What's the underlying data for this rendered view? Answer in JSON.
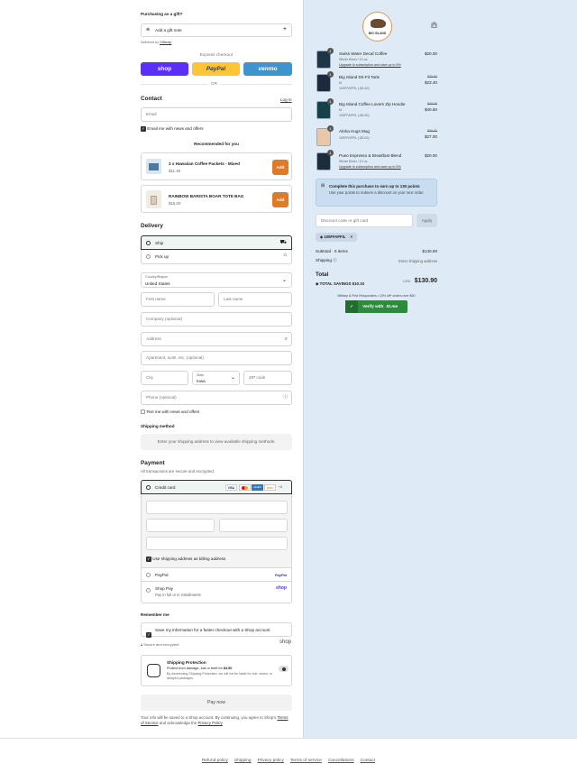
{
  "gift": {
    "title": "Purchasing as a gift?",
    "add_note": "Add a gift note",
    "delivered_by": "Delivered by",
    "delivered_by_brand": "Giftsnap"
  },
  "express": {
    "title": "Express checkout",
    "shop": "shop",
    "paypal": "PayPal",
    "venmo": "venmo",
    "or": "OR"
  },
  "contact": {
    "title": "Contact",
    "login": "Log in",
    "email_placeholder": "Email",
    "news": "Email me with news and offers"
  },
  "recommended": {
    "title": "Recommended for you",
    "items": [
      {
        "name": "3 x Hawaiian Coffee Packets - Mixed",
        "price": "$11.40",
        "add": "Add"
      },
      {
        "name": "RAINBOW BARISTA BOAR TOTE BAG",
        "price": "$15.00",
        "add": "Add"
      }
    ]
  },
  "delivery": {
    "title": "Delivery",
    "ship": "Ship",
    "pickup": "Pick up",
    "country_label": "Country/Region",
    "country": "United States",
    "first": "First name",
    "last": "Last name",
    "company": "Company (optional)",
    "address": "Address",
    "apt": "Apartment, suite, etc. (optional)",
    "city": "City",
    "state_label": "State",
    "state": "Iowa",
    "zip": "ZIP code",
    "phone": "Phone (optional)",
    "text_me": "Text me with news and offers"
  },
  "shipping_method": {
    "title": "Shipping method",
    "msg": "Enter your shipping address to view available shipping methods."
  },
  "payment": {
    "title": "Payment",
    "subtitle": "All transactions are secure and encrypted.",
    "credit": "Credit card",
    "cards": [
      "VISA",
      "MC",
      "AMEX",
      "DISC"
    ],
    "more": "+2",
    "billing": "Use shipping address as billing address",
    "paypal": "PayPal",
    "paypal_logo": "PayPal",
    "shoppay": "Shop Pay",
    "shoppay_sub": "Pay in full or in installments",
    "shoppay_logo": "shop"
  },
  "remember": {
    "title": "Remember me",
    "save": "Save my information for a faster checkout with a Shop account",
    "secure": "Secure and encrypted",
    "shop_logo": "shop"
  },
  "protection": {
    "title": "Shipping Protection",
    "line1": "Protect from damage, lost or theft for",
    "price": "$4.50",
    "line2": "By deselecting Shipping Protection, we will not be liable for lost, stolen, or delayed packages."
  },
  "pay_now": "Pay now",
  "legal": {
    "text": "Your info will be saved to a Shop account. By continuing, you agree to Shop's",
    "tos": "Terms of Service",
    "and": "and acknowledge the",
    "privacy": "Privacy Policy"
  },
  "logo": {
    "text": "BIG ISLAND"
  },
  "cart": {
    "items": [
      {
        "qty": "1",
        "name": "Swiss Water Decaf Coffee",
        "variant": "Whole Bean / 10 oz.",
        "note": "Upgrade to subscription and save up to 5%",
        "old": "",
        "price": "$20.00",
        "color": "#1d3547"
      },
      {
        "qty": "1",
        "name": "Big Island Dri-Fit Tank",
        "variant": "M",
        "note": "100FFAPFIL (-$3.40)",
        "old": "$30.00",
        "price": "$23.40",
        "color": "#1c2a3c"
      },
      {
        "qty": "1",
        "name": "Big Island Coffee Lovers Zip Hoodie",
        "variant": "M",
        "note": "100FFAPFIL (-$4.50)",
        "old": "$45.00",
        "price": "$40.50",
        "color": "#16404a"
      },
      {
        "qty": "1",
        "name": "Aloha Hugs Mug",
        "variant": "",
        "note": "100FFAPFIL (-$3.00)",
        "old": "$30.00",
        "price": "$27.00",
        "color": "#e8c8a8"
      },
      {
        "qty": "1",
        "name": "Pueo Espresso & Breakfast Blend",
        "variant": "Whole Bean / 10 oz.",
        "note": "Upgrade to subscription and save up to 5%",
        "old": "",
        "price": "$20.00",
        "color": "#1b2c3a"
      }
    ]
  },
  "points": {
    "title": "Complete this purchase to earn up to 130 points",
    "sub": "Use your points to redeem a discount on your next order."
  },
  "discount": {
    "placeholder": "Discount code or gift card",
    "apply": "Apply",
    "code": "100FFAPFIL"
  },
  "totals": {
    "subtotal_label": "Subtotal · 5 items",
    "subtotal": "$130.90",
    "shipping_label": "Shipping",
    "shipping": "Enter shipping address",
    "total_label": "Total",
    "currency": "USD",
    "total": "$130.90",
    "savings_label": "TOTAL SAVINGS",
    "savings": "$10.10"
  },
  "idme": {
    "note": "Military & First Responders • 10% off* orders over $50",
    "btn": "Verify with",
    "brand": "ID.me"
  },
  "footer": [
    "Refund policy",
    "Shipping",
    "Privacy policy",
    "Terms of service",
    "Cancellations",
    "Contact"
  ],
  "colors": {
    "shop": "#5a31f4",
    "paypal": "#ffc439",
    "venmo": "#3d95ce",
    "accent_add": "#e07a24",
    "idme": "#2d8b3c"
  }
}
